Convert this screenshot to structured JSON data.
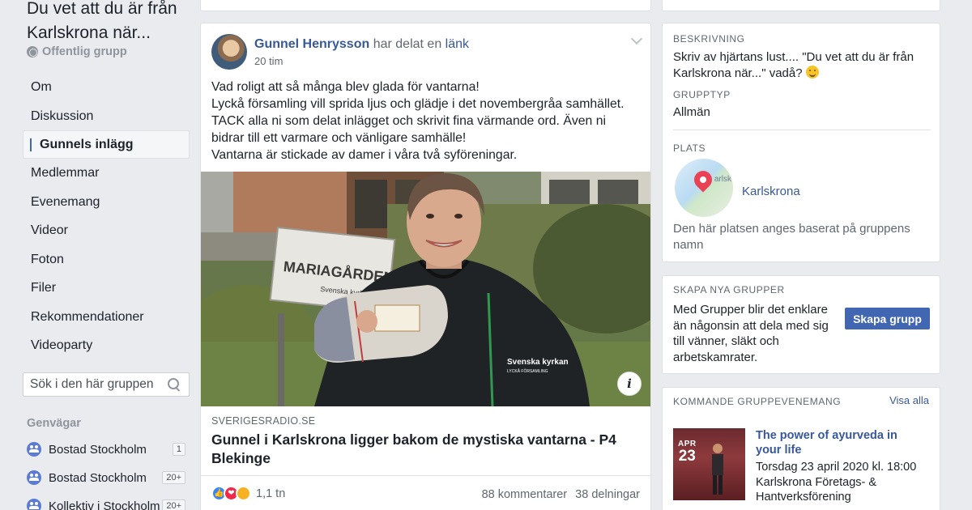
{
  "group": {
    "title": "Du vet att du är från Karlskrona när...",
    "privacy": "Offentlig grupp"
  },
  "nav": {
    "items": [
      {
        "label": "Om"
      },
      {
        "label": "Diskussion"
      },
      {
        "label": "Gunnels inlägg"
      },
      {
        "label": "Medlemmar"
      },
      {
        "label": "Evenemang"
      },
      {
        "label": "Videor"
      },
      {
        "label": "Foton"
      },
      {
        "label": "Filer"
      },
      {
        "label": "Rekommendationer"
      },
      {
        "label": "Videoparty"
      }
    ],
    "active": "Gunnels inlägg"
  },
  "search": {
    "placeholder": "Sök i den här gruppen"
  },
  "shortcuts": {
    "title": "Genvägar",
    "items": [
      {
        "label": "Bostad Stockholm",
        "count": "1"
      },
      {
        "label": "Bostad Stockholm",
        "count": "20+"
      },
      {
        "label": "Kollektiv i Stockholm",
        "count": "20+"
      }
    ]
  },
  "post": {
    "author": "Gunnel Henrysson",
    "action": "har delat en",
    "action_link": "länk",
    "time": "20 tim",
    "text_lines": [
      "Vad roligt att så många blev glada för vantarna!",
      "Lyckå församling vill sprida ljus och glädje i det novembergråa samhället.",
      "TACK alla ni som delat inlägget och skrivit fina värmande ord. Även ni",
      "bidrar till ett varmare och vänligare samhälle!",
      "Vantarna är stickade av damer i våra två syföreningar."
    ],
    "photo": {
      "sign_text": "MARIAGÅRDEN",
      "sign_sub": "Svenska kyrkan",
      "jacket_text": "Svenska kyrkan",
      "jacket_sub": "LYCKÅ FÖRSAMLING"
    },
    "link_domain": "SVERIGESRADIO.SE",
    "link_title": "Gunnel i Karlskrona ligger bakom de mystiska vantarna - P4 Blekinge",
    "reaction_count": "1,1 tn",
    "comments": "88 kommentarer",
    "shares": "38 delningar"
  },
  "about": {
    "description_label": "BESKRIVNING",
    "description": "Skriv av hjärtans lust.... \"Du vet att du är från Karlskrona när...\" vadå?",
    "type_label": "GRUPPTYP",
    "type": "Allmän",
    "place_label": "PLATS",
    "place": "Karlskrona",
    "map_label": "arlsk",
    "place_note": "Den här platsen anges baserat på gruppens namn"
  },
  "create": {
    "label": "SKAPA NYA GRUPPER",
    "text": "Med Grupper blir det enklare än någonsin att dela med sig till vänner, släkt och arbetskamrater.",
    "button": "Skapa grupp"
  },
  "events": {
    "label": "KOMMANDE GRUPPEVENEMANG",
    "see_all": "Visa alla",
    "items": [
      {
        "month": "APR",
        "day": "23",
        "title": "The power of ayurveda in your life",
        "date": "Torsdag 23 april 2020 kl. 18:00",
        "host": "Karlskrona Företags- & Hantverksförening"
      }
    ]
  },
  "colors": {
    "accent": "#4267b2",
    "link": "#385898",
    "background": "#e9ebee"
  }
}
